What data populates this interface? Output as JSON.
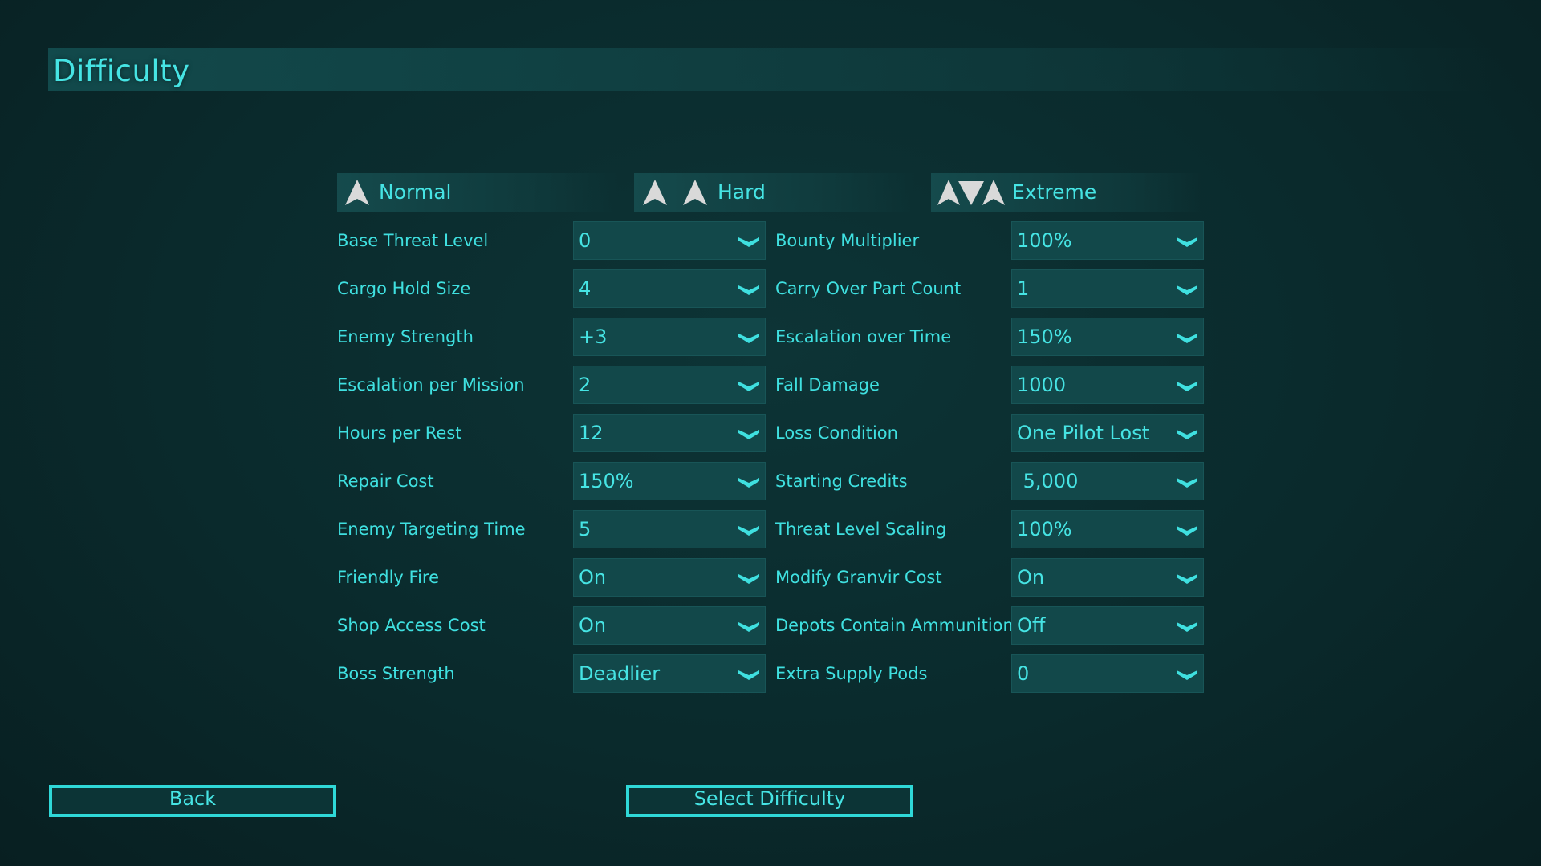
{
  "page": {
    "title": "Difficulty"
  },
  "tabs": [
    {
      "label": "Normal",
      "icon": "single-chevron-up-icon"
    },
    {
      "label": "Hard",
      "icon": "double-chevron-up-icon"
    },
    {
      "label": "Extreme",
      "icon": "triple-chevron-icon"
    }
  ],
  "settings": {
    "left": [
      {
        "label": "Base Threat Level",
        "value": "0"
      },
      {
        "label": "Cargo Hold Size",
        "value": "4"
      },
      {
        "label": "Enemy Strength",
        "value": "+3"
      },
      {
        "label": "Escalation per Mission",
        "value": "2"
      },
      {
        "label": "Hours per Rest",
        "value": "12"
      },
      {
        "label": "Repair Cost",
        "value": "150%"
      },
      {
        "label": "Enemy Targeting Time",
        "value": "5"
      },
      {
        "label": "Friendly Fire",
        "value": "On"
      },
      {
        "label": "Shop Access Cost",
        "value": "On"
      },
      {
        "label": "Boss Strength",
        "value": "Deadlier"
      }
    ],
    "right": [
      {
        "label": "Bounty Multiplier",
        "value": "100%"
      },
      {
        "label": "Carry Over Part Count",
        "value": "1"
      },
      {
        "label": "Escalation over Time",
        "value": "150%"
      },
      {
        "label": "Fall Damage",
        "value": "1000"
      },
      {
        "label": "Loss Condition",
        "value": "One Pilot Lost"
      },
      {
        "label": "Starting Credits",
        "value": " 5,000"
      },
      {
        "label": "Threat Level Scaling",
        "value": "100%"
      },
      {
        "label": "Modify Granvir Cost",
        "value": "On"
      },
      {
        "label": "Depots Contain Ammunition",
        "value": "Off"
      },
      {
        "label": "Extra Supply Pods",
        "value": "0"
      }
    ]
  },
  "buttons": {
    "back_label": "Back",
    "select_label": "Select Difficulty"
  },
  "colors": {
    "accent": "#46e4e4",
    "background": "#0a2a2c",
    "dropdown": "#12484a",
    "icon": "#d9d9d9"
  }
}
